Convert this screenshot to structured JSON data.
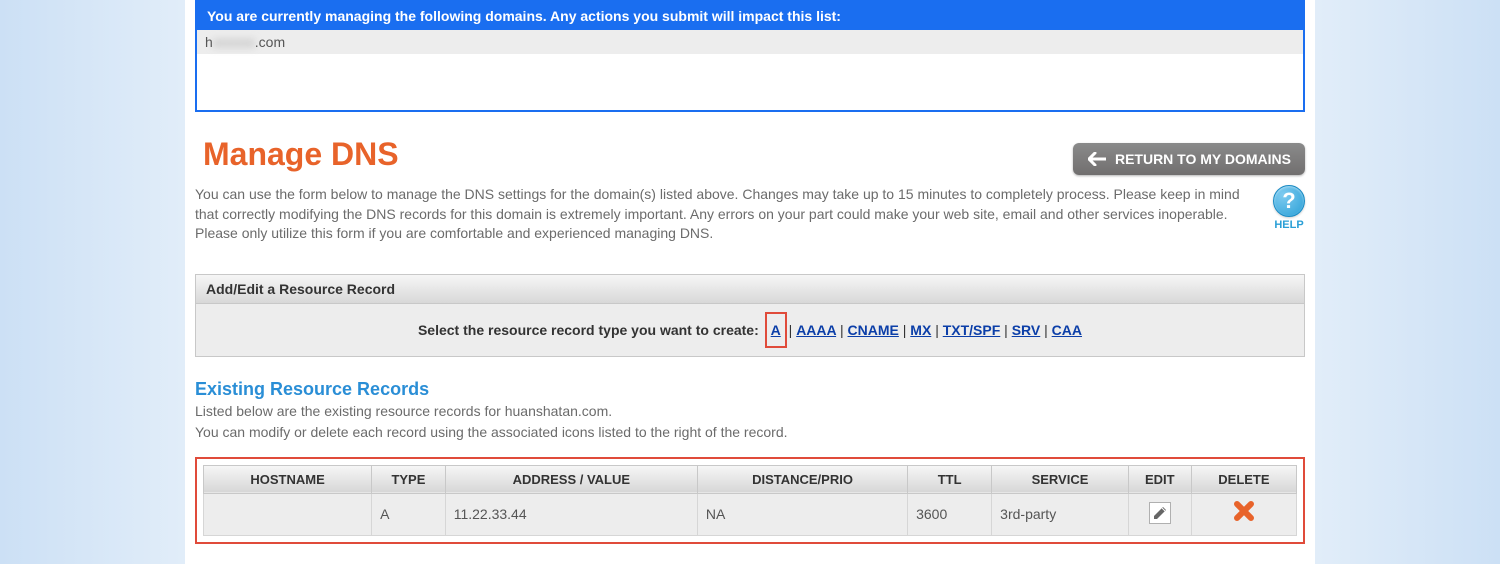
{
  "banner": {
    "header": "You are currently managing the following domains. Any actions you submit will impact this list:",
    "domain_prefix": "h",
    "domain_blur": "xxxxxx",
    "domain_suffix": ".com"
  },
  "title": "Manage DNS",
  "return_button": "RETURN TO MY DOMAINS",
  "intro": "You can use the form below to manage the DNS settings for the domain(s) listed above. Changes may take up to 15 minutes to completely process. Please keep in mind that correctly modifying the DNS records for this domain is extremely important. Any errors on your part could make your web site, email and other services inoperable. Please only utilize this form if you are comfortable and experienced managing DNS.",
  "help": {
    "glyph": "?",
    "label": "HELP"
  },
  "add_edit": {
    "header": "Add/Edit a Resource Record",
    "prompt": "Select the resource record type you want to create:",
    "types": {
      "a": "A",
      "aaaa": "AAAA",
      "cname": "CNAME",
      "mx": "MX",
      "txtspf": "TXT/SPF",
      "srv": "SRV",
      "caa": "CAA"
    }
  },
  "existing": {
    "heading": "Existing Resource Records",
    "line1": "Listed below are the existing resource records for huanshatan.com.",
    "line2": "You can modify or delete each record using the associated icons listed to the right of the record."
  },
  "table": {
    "headers": {
      "hostname": "HOSTNAME",
      "type": "TYPE",
      "address": "ADDRESS / VALUE",
      "distance": "DISTANCE/PRIO",
      "ttl": "TTL",
      "service": "SERVICE",
      "edit": "EDIT",
      "delete": "DELETE"
    },
    "rows": [
      {
        "hostname": "",
        "type": "A",
        "address": "11.22.33.44",
        "distance": "NA",
        "ttl": "3600",
        "service": "3rd-party"
      }
    ]
  }
}
